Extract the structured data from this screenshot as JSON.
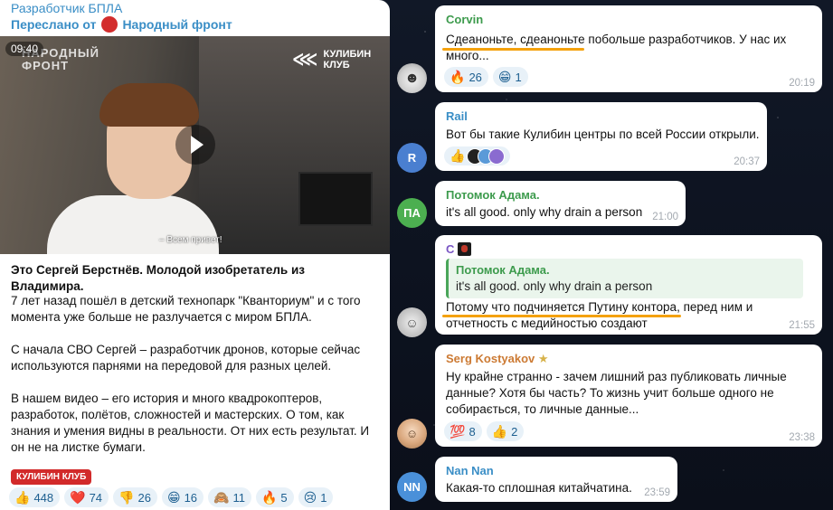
{
  "post": {
    "channel": "Разработчик БПЛА",
    "forwarded_prefix": "Переслано от",
    "forwarded_from": "Народный фронт",
    "video": {
      "duration": "09:40",
      "logo_left_1": "НАРОДНЫЙ",
      "logo_left_2": "ФРОНТ",
      "logo_right_1": "КУЛИБИН",
      "logo_right_2": "КЛУБ",
      "subtitle": "– Всем привет!"
    },
    "headline": "Это Сергей Берстнёв. Молодой изобретатель из Владимира.",
    "p1a": "7 лет назад пошёл в детский технопарк \"Кванториум\" и с того",
    "p1b": "момента уже больше не разлучается с миром БПЛА.",
    "p2a": "С начала СВО Сергей – разработчик дронов, которые сейчас",
    "p2b": "используются парнями на передовой для разных целей.",
    "p3a": "В нашем видео – его история и много квадрокоптеров,",
    "p3b": "разработок, полётов, сложностей и мастерских. О том, как",
    "p3c": "знания и умения видны в реальности. От них есть результат. И",
    "p3d": "он не на листке бумаги.",
    "tag": "КУЛИБИН КЛУБ",
    "reactions": [
      {
        "emoji": "👍",
        "count": "448"
      },
      {
        "emoji": "❤️",
        "count": "74"
      },
      {
        "emoji": "👎",
        "count": "26"
      },
      {
        "emoji": "😁",
        "count": "16"
      },
      {
        "emoji": "🙈",
        "count": "11"
      },
      {
        "emoji": "🔥",
        "count": "5"
      },
      {
        "emoji": "😢",
        "count": "1"
      }
    ]
  },
  "messages": [
    {
      "sender": "Corvin",
      "sender_color": "#3d9b4d",
      "line1": "Сдеаноньте, сдеаноньте побольше разработчиков. У нас их",
      "line2": "много...",
      "time": "20:19",
      "reactions": [
        {
          "emoji": "🔥",
          "count": "26"
        },
        {
          "emoji": "😁",
          "count": "1"
        }
      ]
    },
    {
      "sender": "Rail",
      "sender_color": "#3a8ec6",
      "avatar_letter": "R",
      "line1": "Вот бы такие Кулибин центры по всей России открыли.",
      "time": "20:37",
      "reaction_emoji": "👍"
    },
    {
      "sender": "Потомок Адама.",
      "sender_color": "#3d9b4d",
      "avatar_letter": "ПА",
      "line1": "it's all good. only why drain a person",
      "time": "21:00"
    },
    {
      "sender": "C",
      "sender_color": "#7a56c4",
      "quote_sender": "Потомок Адама.",
      "quote_text": "it's all good. only why drain a person",
      "line1": "Потому что подчиняется Путину контора, перед ним и",
      "line2": "отчетность с медийностью создают",
      "time": "21:55"
    },
    {
      "sender": "Serg Kostyakov",
      "sender_color": "#cc7a33",
      "line1": "Ну крайне странно - зачем лишний раз публиковать личные",
      "line2": "данные?  Хотя бы часть? То жизнь учит больше одного не",
      "line3": "собирається, то личные данные...",
      "time": "23:38",
      "reactions": [
        {
          "emoji": "💯",
          "count": "8"
        },
        {
          "emoji": "👍",
          "count": "2"
        }
      ]
    },
    {
      "sender": "Nan Nan",
      "sender_color": "#3a8ec6",
      "avatar_letter": "NN",
      "line1": "Какая-то сплошная китайчатина.",
      "time": "23:59"
    }
  ]
}
